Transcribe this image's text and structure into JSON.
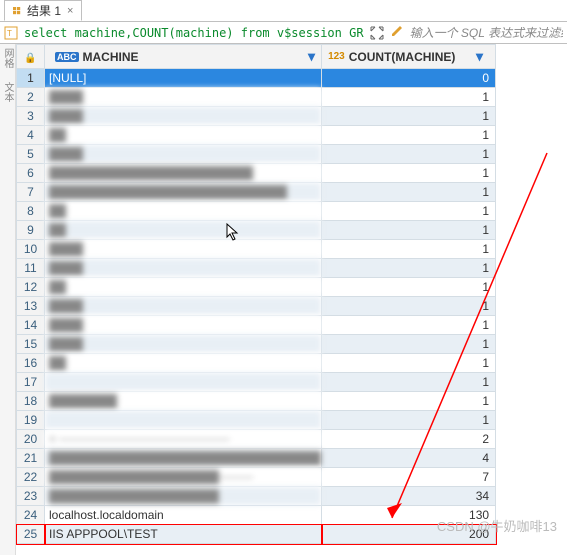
{
  "tab": {
    "label": "结果 1",
    "close": "×"
  },
  "sql": {
    "text": "select machine,COUNT(machine) from v$session GR",
    "hint": "输入一个 SQL 表达式来过滤结果 (使用"
  },
  "columns": {
    "rownum": "",
    "machine": "MACHINE",
    "count": "COUNT(MACHINE)"
  },
  "badges": {
    "abc": "ABC",
    "num": "123"
  },
  "rows": [
    {
      "n": 1,
      "machine": "[NULL]",
      "count": 0,
      "selected": true,
      "blur": false
    },
    {
      "n": 2,
      "machine": "████",
      "count": 1,
      "blur": true
    },
    {
      "n": 3,
      "machine": "████",
      "count": 1,
      "blur": true
    },
    {
      "n": 4,
      "machine": "██",
      "count": 1,
      "blur": true
    },
    {
      "n": 5,
      "machine": "████",
      "count": 1,
      "blur": true
    },
    {
      "n": 6,
      "machine": "████████████████████████",
      "count": 1,
      "blur": true
    },
    {
      "n": 7,
      "machine": "████████████████████████████",
      "count": 1,
      "blur": true
    },
    {
      "n": 8,
      "machine": "██",
      "count": 1,
      "blur": true
    },
    {
      "n": 9,
      "machine": "██",
      "count": 1,
      "blur": true
    },
    {
      "n": 10,
      "machine": "████",
      "count": 1,
      "blur": true
    },
    {
      "n": 11,
      "machine": "████",
      "count": 1,
      "blur": true
    },
    {
      "n": 12,
      "machine": "██",
      "count": 1,
      "blur": true
    },
    {
      "n": 13,
      "machine": "████",
      "count": 1,
      "blur": true
    },
    {
      "n": 14,
      "machine": "████",
      "count": 1,
      "blur": true
    },
    {
      "n": 15,
      "machine": "████",
      "count": 1,
      "blur": true
    },
    {
      "n": 16,
      "machine": "██",
      "count": 1,
      "blur": true
    },
    {
      "n": 17,
      "machine": "",
      "count": 1,
      "blur": true
    },
    {
      "n": 18,
      "machine": "████████",
      "count": 1,
      "blur": true
    },
    {
      "n": 19,
      "machine": "",
      "count": 1,
      "blur": true
    },
    {
      "n": 20,
      "machine": "= ────────────────────",
      "count": 2,
      "blur": true
    },
    {
      "n": 21,
      "machine": "████████████████████████████████",
      "count": 4,
      "blur": true
    },
    {
      "n": 22,
      "machine": "████████████████████────",
      "count": 7,
      "blur": true
    },
    {
      "n": 23,
      "machine": "████████████████████",
      "count": 34,
      "blur": true
    },
    {
      "n": 24,
      "machine": "localhost.localdomain",
      "count": 130,
      "blur": false
    },
    {
      "n": 25,
      "machine": "IIS APPPOOL\\TEST",
      "count": 200,
      "blur": false,
      "highlight": true
    }
  ],
  "sidebar": {
    "label1": "网格",
    "label2": "文本"
  },
  "watermark": "CSDN @牛奶咖啡13"
}
